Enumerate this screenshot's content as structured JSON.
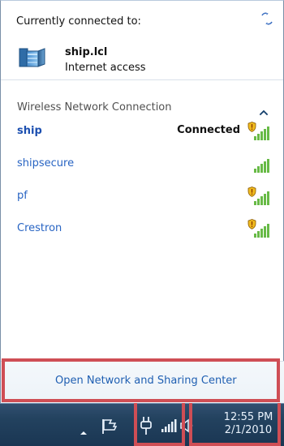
{
  "popup": {
    "currently_connected_label": "Currently connected to:",
    "connected_server": {
      "name": "ship.lcl",
      "status": "Internet access"
    },
    "section_title": "Wireless Network Connection",
    "networks": [
      {
        "name": "ship",
        "status": "Connected",
        "secured": true,
        "selected": true
      },
      {
        "name": "shipsecure",
        "status": "",
        "secured": false,
        "selected": false
      },
      {
        "name": "pf",
        "status": "",
        "secured": true,
        "selected": false
      },
      {
        "name": "Crestron",
        "status": "",
        "secured": true,
        "selected": false
      }
    ],
    "footer_link": "Open Network and Sharing Center"
  },
  "taskbar": {
    "time": "12:55 PM",
    "date": "2/1/2010"
  },
  "icons": {
    "refresh": "refresh-icon",
    "server": "server-icon",
    "collapse": "chevron-up-icon",
    "shield": "security-shield-icon",
    "signal": "signal-bars-icon",
    "tray_arrow": "show-hidden-icons-icon",
    "flag": "action-center-flag-icon",
    "plug": "power-plug-icon",
    "network": "network-icon",
    "volume": "volume-icon"
  },
  "colors": {
    "popup_background": "#ffffff",
    "link_blue": "#2864c3",
    "selected_blue": "#1c4fb0",
    "taskbar_blue": "#23425f",
    "highlight_red": "#cf4e55",
    "signal_green": "#68ba47",
    "shield_yellow": "#f0bb1f"
  }
}
